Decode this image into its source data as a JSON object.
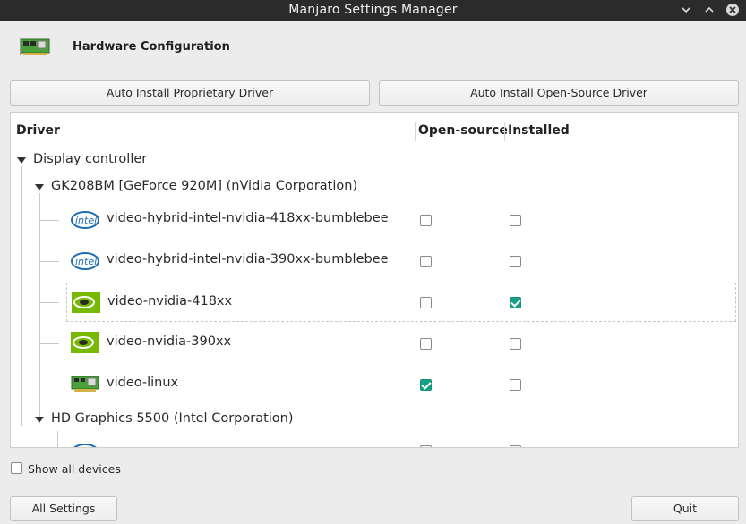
{
  "window": {
    "title": "Manjaro Settings Manager"
  },
  "header": {
    "title": "Hardware Configuration"
  },
  "toolbar": {
    "auto_proprietary_label": "Auto Install Proprietary Driver",
    "auto_opensource_label": "Auto Install Open-Source Driver"
  },
  "table": {
    "columns": {
      "driver": "Driver",
      "open_source": "Open-source",
      "installed": "Installed"
    },
    "category": "Display controller",
    "devices": [
      {
        "name": "GK208BM [GeForce 920M] (nVidia Corporation)",
        "drivers": [
          {
            "name": "video-hybrid-intel-nvidia-418xx-bumblebee",
            "icon": "intel-icon",
            "open_source": false,
            "installed": false,
            "selected": false
          },
          {
            "name": "video-hybrid-intel-nvidia-390xx-bumblebee",
            "icon": "intel-icon",
            "open_source": false,
            "installed": false,
            "selected": false
          },
          {
            "name": "video-nvidia-418xx",
            "icon": "nvidia-icon",
            "open_source": false,
            "installed": true,
            "selected": true
          },
          {
            "name": "video-nvidia-390xx",
            "icon": "nvidia-icon",
            "open_source": false,
            "installed": false,
            "selected": false
          },
          {
            "name": "video-linux",
            "icon": "hardware-card-icon",
            "open_source": true,
            "installed": false,
            "selected": false
          }
        ]
      },
      {
        "name": "HD Graphics 5500 (Intel Corporation)",
        "drivers": []
      }
    ]
  },
  "options": {
    "show_all_devices_label": "Show all devices",
    "show_all_devices_checked": false
  },
  "footer": {
    "all_settings_label": "All Settings",
    "quit_label": "Quit"
  },
  "colors": {
    "accent": "#16a085",
    "titlebar": "#2b2b2b",
    "window_bg": "#ececec"
  }
}
